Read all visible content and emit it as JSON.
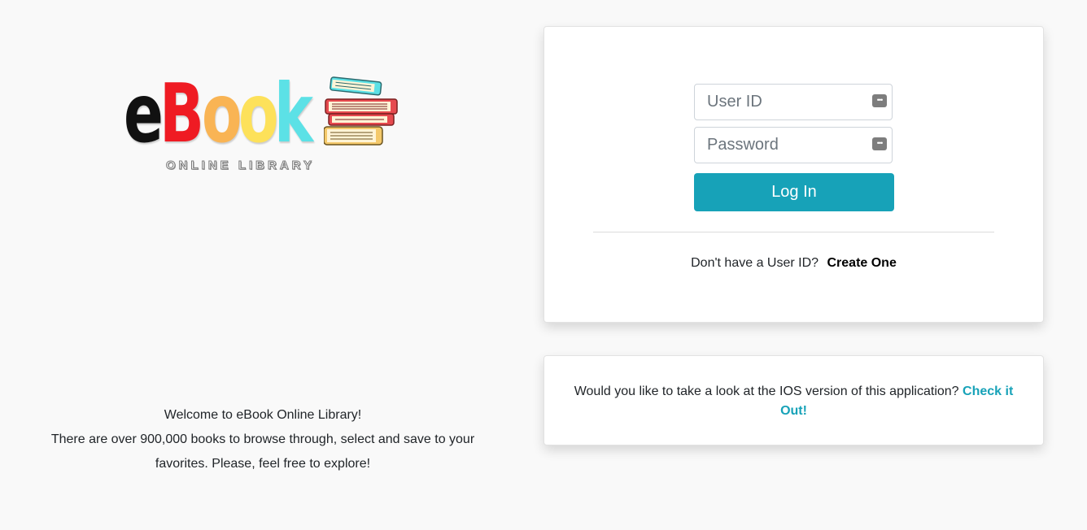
{
  "logo": {
    "letters": [
      {
        "char": "e",
        "color": "#111111"
      },
      {
        "char": "B",
        "color": "#ef1b23"
      },
      {
        "char": "o",
        "color": "#f9b454"
      },
      {
        "char": "o",
        "color": "#fde15a"
      },
      {
        "char": "k",
        "color": "#5ce1e6"
      }
    ],
    "subtitle": "ONLINE LIBRARY",
    "icon": "book-stack-icon"
  },
  "welcome": {
    "line1": "Welcome to eBook Online Library!",
    "line2": "There are over 900,000 books to browse through, select and save to your favorites. Please, feel free to explore!"
  },
  "login": {
    "userid_placeholder": "User ID",
    "password_placeholder": "Password",
    "field_icon": "password-manager-icon",
    "login_label": "Log In",
    "signup_prompt": "Don't have a User ID?",
    "signup_link": "Create One"
  },
  "ios": {
    "text": "Would you like to take a look at the IOS version of this application?",
    "link": "Check it Out!"
  },
  "colors": {
    "accent": "#17a2b8",
    "background": "#f9f9f9"
  }
}
